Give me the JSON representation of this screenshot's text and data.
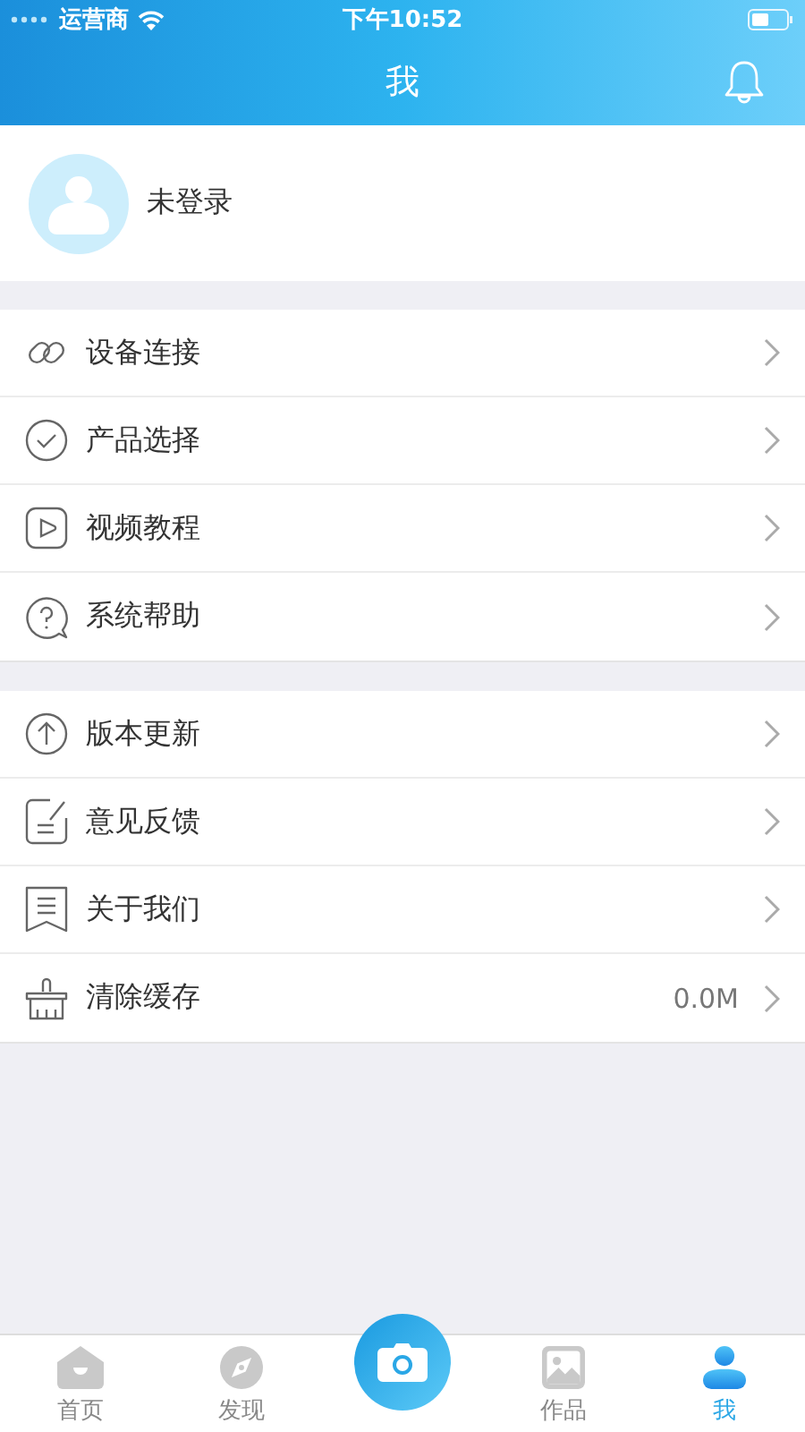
{
  "status_bar": {
    "carrier": "运营商",
    "time": "下午10:52"
  },
  "nav": {
    "title": "我"
  },
  "profile": {
    "name": "未登录"
  },
  "groups": [
    {
      "items": [
        {
          "kind": "link",
          "label": "设备连接"
        },
        {
          "kind": "check",
          "label": "产品选择"
        },
        {
          "kind": "video",
          "label": "视频教程"
        },
        {
          "kind": "help",
          "label": "系统帮助"
        }
      ]
    },
    {
      "items": [
        {
          "kind": "update",
          "label": "版本更新"
        },
        {
          "kind": "feedback",
          "label": "意见反馈"
        },
        {
          "kind": "about",
          "label": "关于我们"
        },
        {
          "kind": "clear",
          "label": "清除缓存",
          "value": "0.0M"
        }
      ]
    }
  ],
  "tabs": [
    {
      "kind": "home",
      "label": "首页",
      "selected": false
    },
    {
      "kind": "discover",
      "label": "发现",
      "selected": false
    },
    {
      "kind": "camera",
      "selected": false
    },
    {
      "kind": "works",
      "label": "作品",
      "selected": false
    },
    {
      "kind": "me",
      "label": "我",
      "selected": true
    }
  ]
}
